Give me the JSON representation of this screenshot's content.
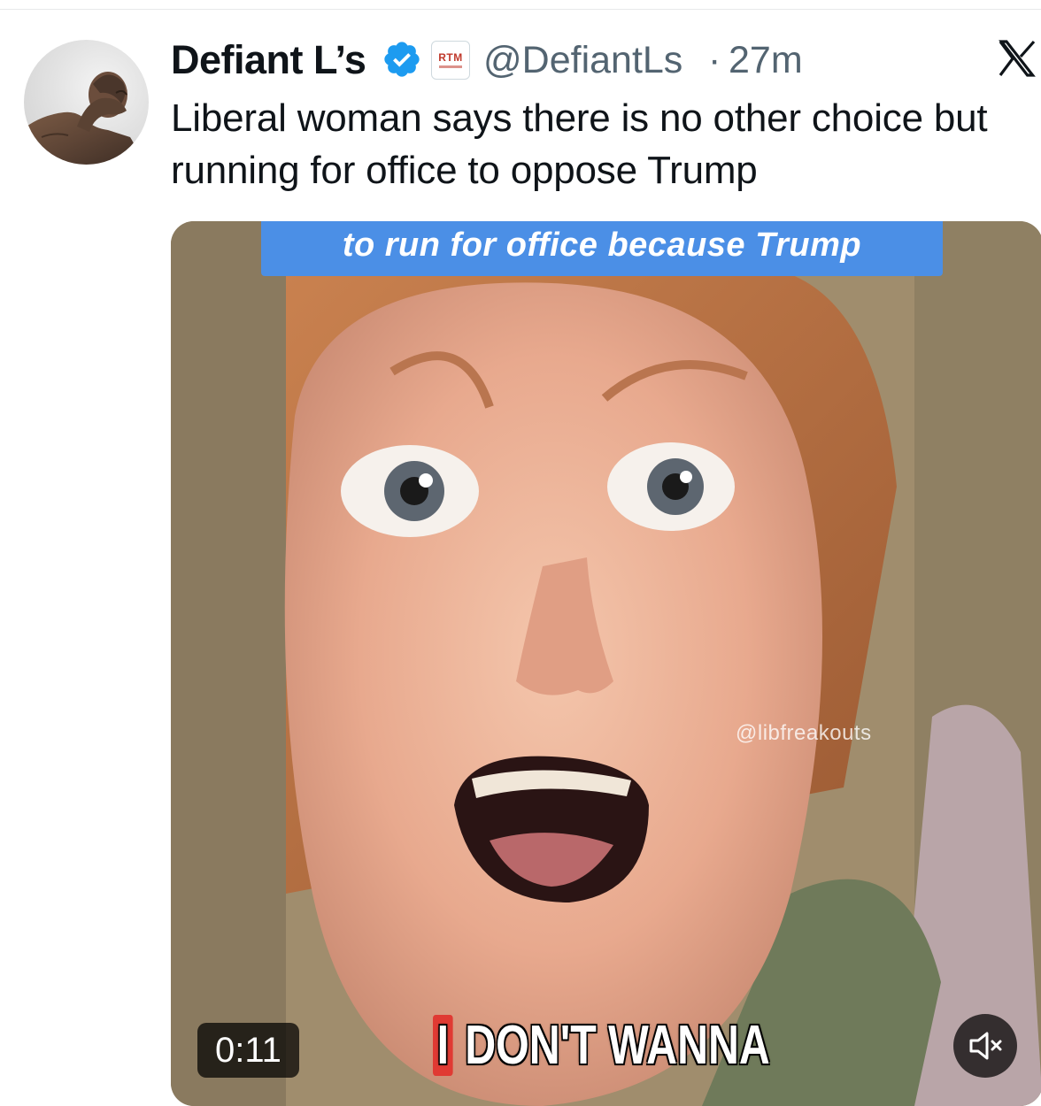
{
  "tweet": {
    "author_name": "Defiant L’s",
    "affiliate_badge": "RTM",
    "handle": "@DefiantLs",
    "separator": "·",
    "time": "27m",
    "text": "Liberal woman says there is no other choice but running for office to oppose Trump"
  },
  "media": {
    "caption_top": "to run for office because Trump",
    "watermark": "@libfreakouts",
    "caption_bottom_highlight": "I",
    "caption_bottom_rest": " DON'T WANNA",
    "duration": "0:11"
  },
  "icons": {
    "avatar": "statue-avatar",
    "verified": "verified-badge-icon",
    "platform": "x-logo-icon",
    "mute": "speaker-muted-icon"
  },
  "colors": {
    "verified_blue": "#1d9bf0",
    "caption_banner": "#4b8fe6",
    "caption_highlight": "#e03a33",
    "secondary_text": "#536471"
  }
}
